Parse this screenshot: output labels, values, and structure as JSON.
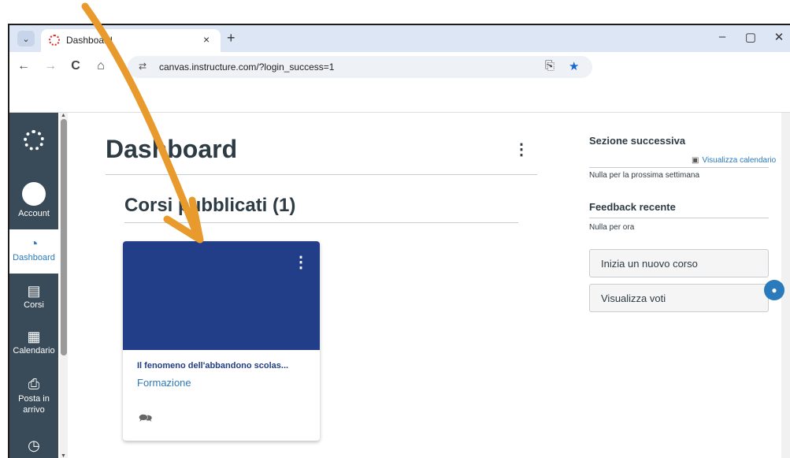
{
  "browser": {
    "tab_title": "Dashboard",
    "tab_close": "×",
    "new_tab": "+",
    "tab_menu": "⌄",
    "window": {
      "minimize": "–",
      "maximize": "▢",
      "close": "✕"
    },
    "nav": {
      "back": "←",
      "forward": "→",
      "reload": "C",
      "home": "⌂"
    },
    "url": "canvas.instructure.com/?login_success=1",
    "site_info_icon": "⇄",
    "install_icon": "⎘",
    "bookmark_star": "★"
  },
  "global_nav": {
    "items": [
      {
        "label": "Account",
        "icon": "avatar"
      },
      {
        "label": "Dashboard",
        "icon": "dashboard-icon",
        "active": true
      },
      {
        "label": "Corsi",
        "icon": "courses-icon"
      },
      {
        "label": "Calendario",
        "icon": "calendar-icon"
      },
      {
        "label": "Posta in arrivo",
        "icon": "inbox-icon"
      },
      {
        "label": "",
        "icon": "history-icon"
      }
    ],
    "icons": {
      "dashboard": "◔",
      "courses": "▤",
      "calendar": "▦",
      "inbox": "⎙",
      "history": "◷"
    }
  },
  "main": {
    "title": "Dashboard",
    "options": "⋮",
    "section_title": "Corsi pubblicati (1)",
    "card": {
      "title": "Il fenomeno dell'abbandono scolas...",
      "subtitle": "Formazione",
      "options": "⋮",
      "color": "#223e88",
      "discussions_icon": "🗪"
    }
  },
  "sidebar": {
    "coming_up": "Sezione successiva",
    "view_calendar": "Visualizza calendario",
    "coming_up_empty": "Nulla per la prossima settimana",
    "recent_feedback": "Feedback recente",
    "recent_feedback_empty": "Nulla per ora",
    "start_new_course": "Inizia un nuovo corso",
    "view_grades": "Visualizza voti"
  },
  "colors": {
    "nav_bg": "#394b58",
    "card_hero": "#223e88",
    "link": "#2b7abc",
    "annotation_arrow": "#e89a2c"
  }
}
